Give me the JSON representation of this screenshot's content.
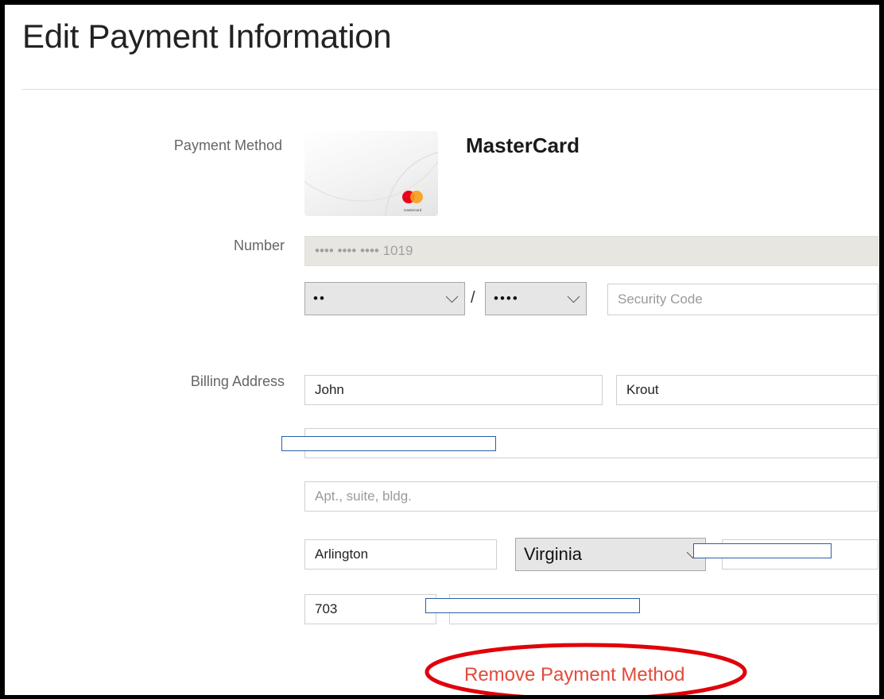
{
  "page": {
    "title": "Edit Payment Information"
  },
  "labels": {
    "payment_method": "Payment Method",
    "number": "Number",
    "billing_address": "Billing Address"
  },
  "card": {
    "brand": "MasterCard",
    "logo_text": "mastercard",
    "number_masked": "•••• •••• •••• 1019"
  },
  "expiry": {
    "month_value": "••",
    "separator": "/",
    "year_value": "••••"
  },
  "security_code": {
    "placeholder": "Security Code",
    "value": ""
  },
  "billing": {
    "first_name": "John",
    "last_name": "Krout",
    "street": "",
    "apt_placeholder": "Apt., suite, bldg.",
    "city": "Arlington",
    "state": "Virginia",
    "area_code": "703"
  },
  "actions": {
    "remove_label": "Remove Payment Method"
  },
  "colors": {
    "remove_link": "#e24a3a",
    "annotation_ellipse": "#e0000a",
    "redaction_border": "#2a5fa8",
    "mastercard_red": "#eb001b",
    "mastercard_orange": "#f79e1b"
  },
  "icons": {
    "dropdown": "chevron-down-icon",
    "card_logo": "mastercard-logo-icon"
  }
}
